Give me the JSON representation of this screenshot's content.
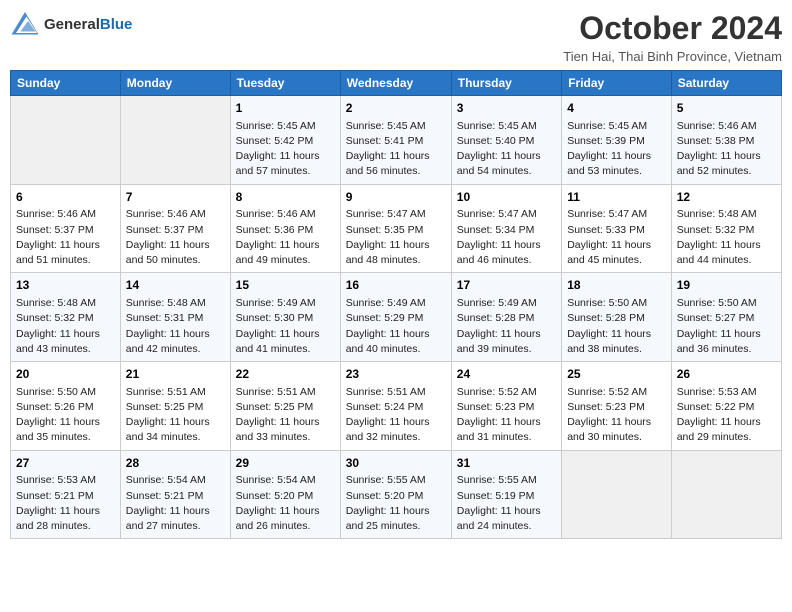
{
  "header": {
    "logo": {
      "general": "General",
      "blue": "Blue"
    },
    "title": "October 2024",
    "subtitle": "Tien Hai, Thai Binh Province, Vietnam"
  },
  "days_of_week": [
    "Sunday",
    "Monday",
    "Tuesday",
    "Wednesday",
    "Thursday",
    "Friday",
    "Saturday"
  ],
  "weeks": [
    [
      {
        "day": "",
        "empty": true
      },
      {
        "day": "",
        "empty": true
      },
      {
        "day": "1",
        "sunrise": "5:45 AM",
        "sunset": "5:42 PM",
        "daylight": "11 hours and 57 minutes."
      },
      {
        "day": "2",
        "sunrise": "5:45 AM",
        "sunset": "5:41 PM",
        "daylight": "11 hours and 56 minutes."
      },
      {
        "day": "3",
        "sunrise": "5:45 AM",
        "sunset": "5:40 PM",
        "daylight": "11 hours and 54 minutes."
      },
      {
        "day": "4",
        "sunrise": "5:45 AM",
        "sunset": "5:39 PM",
        "daylight": "11 hours and 53 minutes."
      },
      {
        "day": "5",
        "sunrise": "5:46 AM",
        "sunset": "5:38 PM",
        "daylight": "11 hours and 52 minutes."
      }
    ],
    [
      {
        "day": "6",
        "sunrise": "5:46 AM",
        "sunset": "5:37 PM",
        "daylight": "11 hours and 51 minutes."
      },
      {
        "day": "7",
        "sunrise": "5:46 AM",
        "sunset": "5:37 PM",
        "daylight": "11 hours and 50 minutes."
      },
      {
        "day": "8",
        "sunrise": "5:46 AM",
        "sunset": "5:36 PM",
        "daylight": "11 hours and 49 minutes."
      },
      {
        "day": "9",
        "sunrise": "5:47 AM",
        "sunset": "5:35 PM",
        "daylight": "11 hours and 48 minutes."
      },
      {
        "day": "10",
        "sunrise": "5:47 AM",
        "sunset": "5:34 PM",
        "daylight": "11 hours and 46 minutes."
      },
      {
        "day": "11",
        "sunrise": "5:47 AM",
        "sunset": "5:33 PM",
        "daylight": "11 hours and 45 minutes."
      },
      {
        "day": "12",
        "sunrise": "5:48 AM",
        "sunset": "5:32 PM",
        "daylight": "11 hours and 44 minutes."
      }
    ],
    [
      {
        "day": "13",
        "sunrise": "5:48 AM",
        "sunset": "5:32 PM",
        "daylight": "11 hours and 43 minutes."
      },
      {
        "day": "14",
        "sunrise": "5:48 AM",
        "sunset": "5:31 PM",
        "daylight": "11 hours and 42 minutes."
      },
      {
        "day": "15",
        "sunrise": "5:49 AM",
        "sunset": "5:30 PM",
        "daylight": "11 hours and 41 minutes."
      },
      {
        "day": "16",
        "sunrise": "5:49 AM",
        "sunset": "5:29 PM",
        "daylight": "11 hours and 40 minutes."
      },
      {
        "day": "17",
        "sunrise": "5:49 AM",
        "sunset": "5:28 PM",
        "daylight": "11 hours and 39 minutes."
      },
      {
        "day": "18",
        "sunrise": "5:50 AM",
        "sunset": "5:28 PM",
        "daylight": "11 hours and 38 minutes."
      },
      {
        "day": "19",
        "sunrise": "5:50 AM",
        "sunset": "5:27 PM",
        "daylight": "11 hours and 36 minutes."
      }
    ],
    [
      {
        "day": "20",
        "sunrise": "5:50 AM",
        "sunset": "5:26 PM",
        "daylight": "11 hours and 35 minutes."
      },
      {
        "day": "21",
        "sunrise": "5:51 AM",
        "sunset": "5:25 PM",
        "daylight": "11 hours and 34 minutes."
      },
      {
        "day": "22",
        "sunrise": "5:51 AM",
        "sunset": "5:25 PM",
        "daylight": "11 hours and 33 minutes."
      },
      {
        "day": "23",
        "sunrise": "5:51 AM",
        "sunset": "5:24 PM",
        "daylight": "11 hours and 32 minutes."
      },
      {
        "day": "24",
        "sunrise": "5:52 AM",
        "sunset": "5:23 PM",
        "daylight": "11 hours and 31 minutes."
      },
      {
        "day": "25",
        "sunrise": "5:52 AM",
        "sunset": "5:23 PM",
        "daylight": "11 hours and 30 minutes."
      },
      {
        "day": "26",
        "sunrise": "5:53 AM",
        "sunset": "5:22 PM",
        "daylight": "11 hours and 29 minutes."
      }
    ],
    [
      {
        "day": "27",
        "sunrise": "5:53 AM",
        "sunset": "5:21 PM",
        "daylight": "11 hours and 28 minutes."
      },
      {
        "day": "28",
        "sunrise": "5:54 AM",
        "sunset": "5:21 PM",
        "daylight": "11 hours and 27 minutes."
      },
      {
        "day": "29",
        "sunrise": "5:54 AM",
        "sunset": "5:20 PM",
        "daylight": "11 hours and 26 minutes."
      },
      {
        "day": "30",
        "sunrise": "5:55 AM",
        "sunset": "5:20 PM",
        "daylight": "11 hours and 25 minutes."
      },
      {
        "day": "31",
        "sunrise": "5:55 AM",
        "sunset": "5:19 PM",
        "daylight": "11 hours and 24 minutes."
      },
      {
        "day": "",
        "empty": true
      },
      {
        "day": "",
        "empty": true
      }
    ]
  ],
  "labels": {
    "sunrise_prefix": "Sunrise: ",
    "sunset_prefix": "Sunset: ",
    "daylight_prefix": "Daylight: "
  }
}
